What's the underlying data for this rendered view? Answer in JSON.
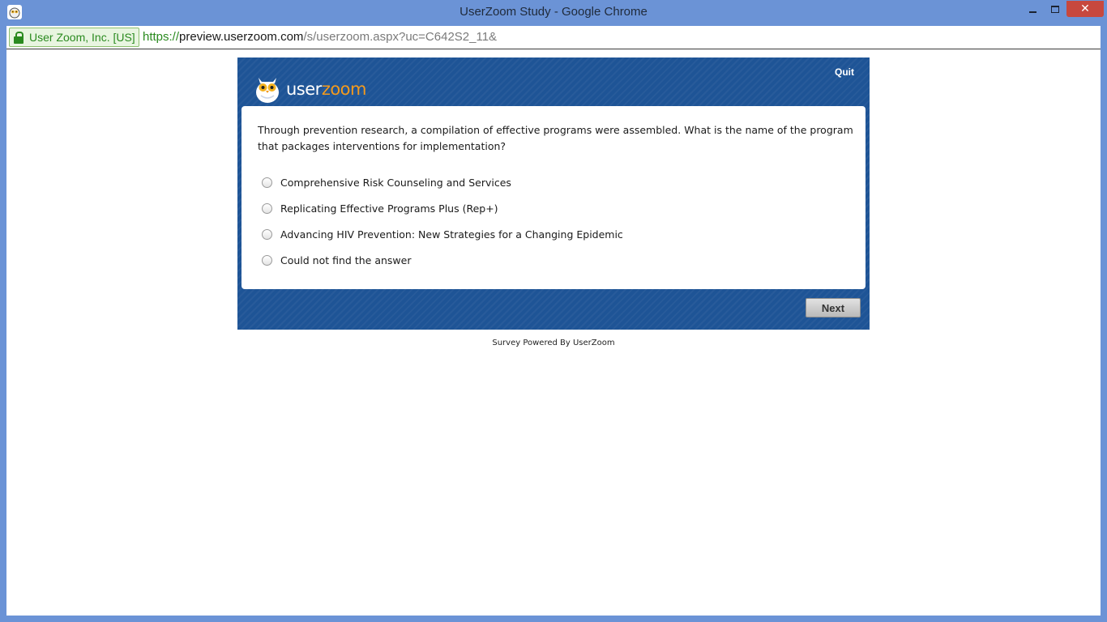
{
  "window": {
    "title": "UserZoom Study - Google Chrome",
    "close_glyph": "✕"
  },
  "addressbar": {
    "ev_label": "User Zoom, Inc. [US]",
    "url_scheme": "https://",
    "url_host": "preview.userzoom.com",
    "url_path": "/s/userzoom.aspx?uc=C642S2_11&"
  },
  "survey": {
    "logo": {
      "user": "user",
      "zoom": "zoom"
    },
    "quit_label": "Quit",
    "question": "Through prevention research, a compilation of effective programs were assembled. What is the name of the program that packages interventions for implementation?",
    "options": [
      {
        "label": "Comprehensive Risk Counseling and Services"
      },
      {
        "label": "Replicating Effective Programs Plus (Rep+)"
      },
      {
        "label": "Advancing HIV Prevention: New Strategies for a Changing Epidemic"
      },
      {
        "label": "Could not find the answer"
      }
    ],
    "next_label": "Next",
    "footer": "Survey Powered By UserZoom"
  },
  "colors": {
    "frame": "#6b93d6",
    "survey_bg": "#1e5496",
    "brand_orange": "#f39a1e",
    "secure_green": "#2a8a1f"
  }
}
